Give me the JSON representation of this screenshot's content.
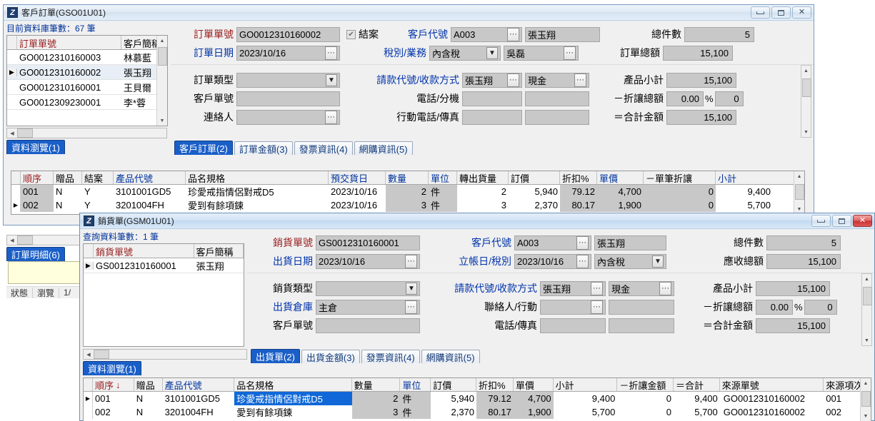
{
  "window1": {
    "title": "客戶訂單(GSO01U01)",
    "logo": "Z",
    "buttons": {
      "minimize": "minimize-icon",
      "maximize": "maximize-icon",
      "close": "close-icon"
    },
    "browse": {
      "count_label": "目前資料庫筆數：67 筆",
      "headers": [
        "訂單單號",
        "客戶簡稱"
      ],
      "rows": [
        {
          "no": "GO0012310160003",
          "name": "林慕藍",
          "selected": false
        },
        {
          "no": "GO0012310160002",
          "name": "張玉翔",
          "selected": true
        },
        {
          "no": "GO0012310160001",
          "name": "王貝爾",
          "selected": false
        },
        {
          "no": "GO0012309230001",
          "name": "李*蓉",
          "selected": false
        }
      ],
      "tab_label": "資料瀏覽(1)",
      "detail_tab_label": "訂單明細(6)"
    },
    "form": {
      "order_no_label": "訂單單號",
      "order_no_value": "GO0012310160002",
      "closed_label": "結案",
      "closed_checked": true,
      "customer_code_label": "客戶代號",
      "customer_code_value": "A003",
      "customer_name_value": "張玉翔",
      "total_qty_label": "總件數",
      "total_qty_value": "5",
      "order_date_label": "訂單日期",
      "order_date_value": "2023/10/16",
      "tax_sales_label": "稅別/業務",
      "tax_value": "內含稅",
      "sales_value": "吳磊",
      "order_total_label": "訂單總額",
      "order_total_value": "15,100",
      "order_type_label": "訂單類型",
      "order_type_value": "",
      "billing_payment_label": "請款代號/收款方式",
      "billing_value": "張玉翔",
      "payment_value": "現金",
      "subtotal_label": "產品小計",
      "subtotal_value": "15,100",
      "customer_order_no_label": "客戶單號",
      "customer_order_no_value": "",
      "phone_ext_label": "電話/分機",
      "phone_value": "",
      "ext_value": "",
      "discount_label": "－折讓總額",
      "discount_pct": "0.00",
      "percent_sign": "%",
      "discount_value": "0",
      "contact_label": "連絡人",
      "contact_value": "",
      "mobile_fax_label": "行動電話/傳真",
      "mobile_value": "",
      "fax_value": "",
      "grand_total_label": "＝合計金額",
      "grand_total_value": "15,100"
    },
    "tabs": [
      {
        "label": "客戶訂單(2)",
        "active": true
      },
      {
        "label": "訂單金額(3)",
        "active": false
      },
      {
        "label": "發票資訊(4)",
        "active": false
      },
      {
        "label": "網購資訊(5)",
        "active": false
      }
    ],
    "grid": {
      "headers": [
        "順序",
        "贈品",
        "結案",
        "產品代號",
        "品名規格",
        "預交貨日",
        "數量",
        "單位",
        "轉出貨量",
        "訂價",
        "折扣%",
        "單價",
        "－單筆折讓",
        "小計"
      ],
      "rows": [
        {
          "marker": "",
          "cells": [
            "001",
            "N",
            "Y",
            "3101001GD5",
            "珍愛戒指情侶對戒D5",
            "2023/10/16",
            "2",
            "件",
            "2",
            "5,940",
            "79.12",
            "4,700",
            "0",
            "9,400"
          ]
        },
        {
          "marker": "▶",
          "cells": [
            "002",
            "N",
            "Y",
            "3201004FH",
            "愛到有餘項鍊",
            "2023/10/16",
            "3",
            "件",
            "3",
            "2,370",
            "80.17",
            "1,900",
            "0",
            "5,700"
          ]
        }
      ]
    },
    "status": [
      "狀態",
      "瀏覽",
      "1/"
    ]
  },
  "window2": {
    "title": "銷貨單(GSM01U01)",
    "logo": "Z",
    "buttons": {
      "minimize": "minimize-icon",
      "maximize": "maximize-icon",
      "close": "close-icon"
    },
    "browse": {
      "count_label": "查詢資料筆數：1 筆",
      "headers": [
        "銷貨單號",
        "客戶簡稱"
      ],
      "rows": [
        {
          "no": "GS0012310160001",
          "name": "張玉翔",
          "selected": true
        }
      ],
      "tab_label": "資料瀏覽(1)"
    },
    "form": {
      "sales_no_label": "銷貨單號",
      "sales_no_value": "GS0012310160001",
      "customer_code_label": "客戶代號",
      "customer_code_value": "A003",
      "customer_name_value": "張玉翔",
      "total_qty_label": "總件數",
      "total_qty_value": "5",
      "ship_date_label": "出貨日期",
      "ship_date_value": "2023/10/16",
      "post_date_tax_label": "立帳日/稅別",
      "post_date_value": "2023/10/16",
      "tax_value": "內含稅",
      "receivable_label": "應收總額",
      "receivable_value": "15,100",
      "sales_type_label": "銷貨類型",
      "sales_type_value": "",
      "billing_payment_label": "請款代號/收款方式",
      "billing_value": "張玉翔",
      "payment_value": "現金",
      "subtotal_label": "產品小計",
      "subtotal_value": "15,100",
      "warehouse_label": "出貨倉庫",
      "warehouse_value": "主倉",
      "contact_mobile_label": "聯絡人/行動",
      "contact_value": "",
      "mobile_value": "",
      "discount_label": "－折讓總額",
      "discount_pct": "0.00",
      "percent_sign": "%",
      "discount_value": "0",
      "customer_order_no_label": "客戶單號",
      "customer_order_no_value": "",
      "phone_fax_label": "電話/傳真",
      "phone_value": "",
      "fax_value": "",
      "grand_total_label": "＝合計金額",
      "grand_total_value": "15,100"
    },
    "tabs": [
      {
        "label": "出貨單(2)",
        "active": true
      },
      {
        "label": "出貨金額(3)",
        "active": false
      },
      {
        "label": "發票資訊(4)",
        "active": false
      },
      {
        "label": "網購資訊(5)",
        "active": false
      }
    ],
    "grid": {
      "headers": [
        "順序",
        "贈品",
        "產品代號",
        "品名規格",
        "數量",
        "單位",
        "訂價",
        "折扣%",
        "單價",
        "小計",
        "－折讓金額",
        "＝合計",
        "來源單號",
        "來源項次"
      ],
      "sort_indicator": "↓",
      "rows": [
        {
          "marker": "▶",
          "cells": [
            "001",
            "N",
            "3101001GD5",
            "珍愛戒指情侶對戒D5",
            "2",
            "件",
            "5,940",
            "79.12",
            "4,700",
            "9,400",
            "0",
            "9,400",
            "GO0012310160002",
            "001"
          ]
        },
        {
          "marker": "",
          "cells": [
            "002",
            "N",
            "3201004FH",
            "愛到有餘項鍊",
            "3",
            "件",
            "2,370",
            "80.17",
            "1,900",
            "5,700",
            "0",
            "5,700",
            "GO0012310160002",
            "002"
          ]
        }
      ]
    }
  },
  "colors": {
    "accent_blue": "#1a5fc8",
    "label_blue": "#0033aa",
    "label_red": "#9b2020",
    "field_grey": "#c8c8c8",
    "selection_blue": "#1068d8",
    "close_red": "#c83232"
  }
}
